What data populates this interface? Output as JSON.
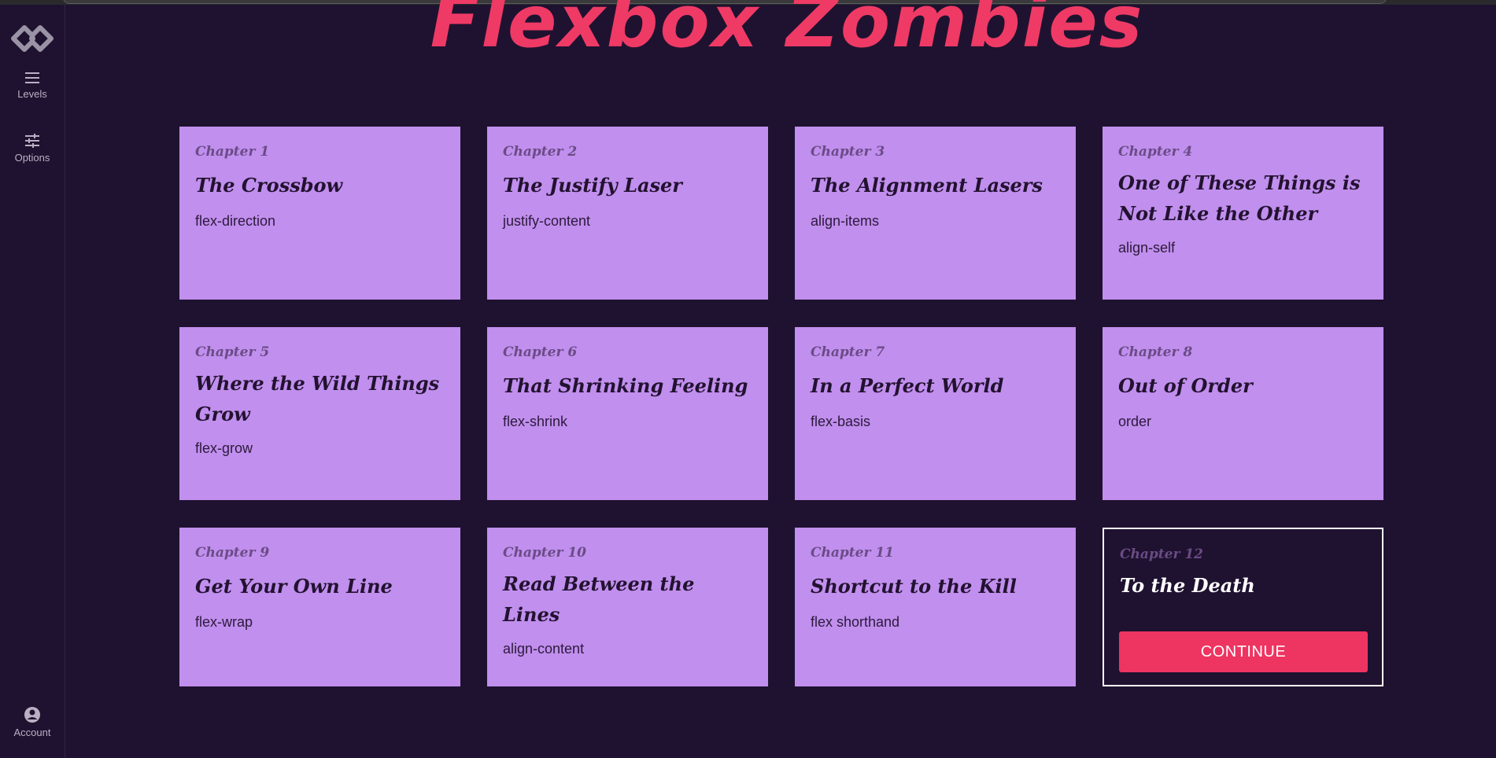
{
  "app": {
    "title": "Flexbox Zombies"
  },
  "sidebar": {
    "levels_label": "Levels",
    "options_label": "Options",
    "account_label": "Account"
  },
  "chapters": [
    {
      "chapter": "Chapter 1",
      "title": "The Crossbow",
      "property": "flex-direction"
    },
    {
      "chapter": "Chapter 2",
      "title": "The Justify Laser",
      "property": "justify-content"
    },
    {
      "chapter": "Chapter 3",
      "title": "The Alignment Lasers",
      "property": "align-items"
    },
    {
      "chapter": "Chapter 4",
      "title": "One of These Things is Not Like the Other",
      "property": "align-self"
    },
    {
      "chapter": "Chapter 5",
      "title": "Where the Wild Things Grow",
      "property": "flex-grow"
    },
    {
      "chapter": "Chapter 6",
      "title": "That Shrinking Feeling",
      "property": "flex-shrink"
    },
    {
      "chapter": "Chapter 7",
      "title": "In a Perfect World",
      "property": "flex-basis"
    },
    {
      "chapter": "Chapter 8",
      "title": "Out of Order",
      "property": "order"
    },
    {
      "chapter": "Chapter 9",
      "title": "Get Your Own Line",
      "property": "flex-wrap"
    },
    {
      "chapter": "Chapter 10",
      "title": "Read Between the Lines",
      "property": "align-content"
    },
    {
      "chapter": "Chapter 11",
      "title": "Shortcut to the Kill",
      "property": "flex shorthand"
    },
    {
      "chapter": "Chapter 12",
      "title": "To the Death",
      "button": "CONTINUE"
    }
  ],
  "colors": {
    "accent": "#ee3461",
    "card": "#c18fee",
    "background": "#1f1230"
  }
}
